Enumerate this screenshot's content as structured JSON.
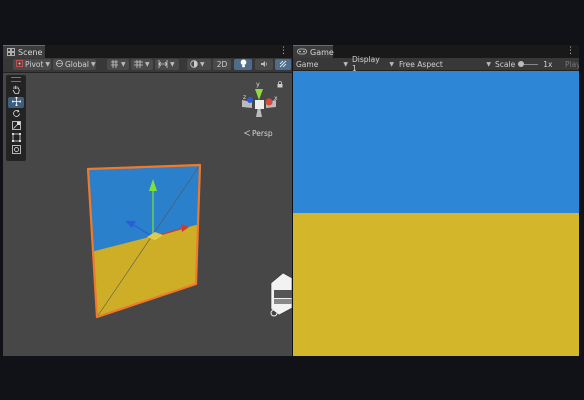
{
  "scene": {
    "tab_label": "Scene",
    "menu": "⋮",
    "toolbar": {
      "pivot_label": "Pivot",
      "global_label": "Global",
      "mode_2d_label": "2D"
    },
    "gizmo": {
      "y_label": "y",
      "x_label": "x",
      "z_label": "z",
      "persp_label": "Persp"
    },
    "tools": [
      "view",
      "move",
      "rotate",
      "scale",
      "rect",
      "transform"
    ],
    "active_tool": "move"
  },
  "game": {
    "tab_label": "Game",
    "menu": "⋮",
    "toolbar": {
      "mode_label": "Game",
      "display_label": "Display 1",
      "aspect_label": "Free Aspect",
      "scale_label": "Scale",
      "scale_value": "1x",
      "play_label": "Play"
    }
  },
  "colors": {
    "sky": "#2e86d6",
    "ground": "#d4b62b",
    "selection_outline": "#f07a2a",
    "scene_bg": "#474747"
  }
}
